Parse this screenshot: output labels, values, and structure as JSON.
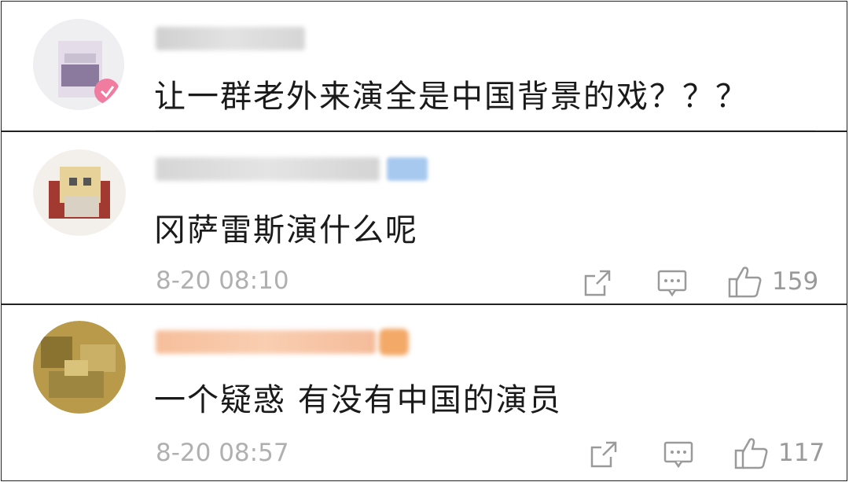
{
  "comments": [
    {
      "text": "让一群老外来演全是中国背景的戏？？？"
    },
    {
      "text": "冈萨雷斯演什么呢",
      "time": "8-20 08:10",
      "likes": "159"
    },
    {
      "text": "一个疑惑 有没有中国的演员",
      "time": "8-20 08:57",
      "likes": "117"
    }
  ],
  "icons": {
    "share": "share-icon",
    "reply": "comment-icon",
    "like": "thumbs-up-icon"
  },
  "colors": {
    "text": "#1a1a1a",
    "meta": "#b0b0b0",
    "icon": "#9a9a9a"
  }
}
